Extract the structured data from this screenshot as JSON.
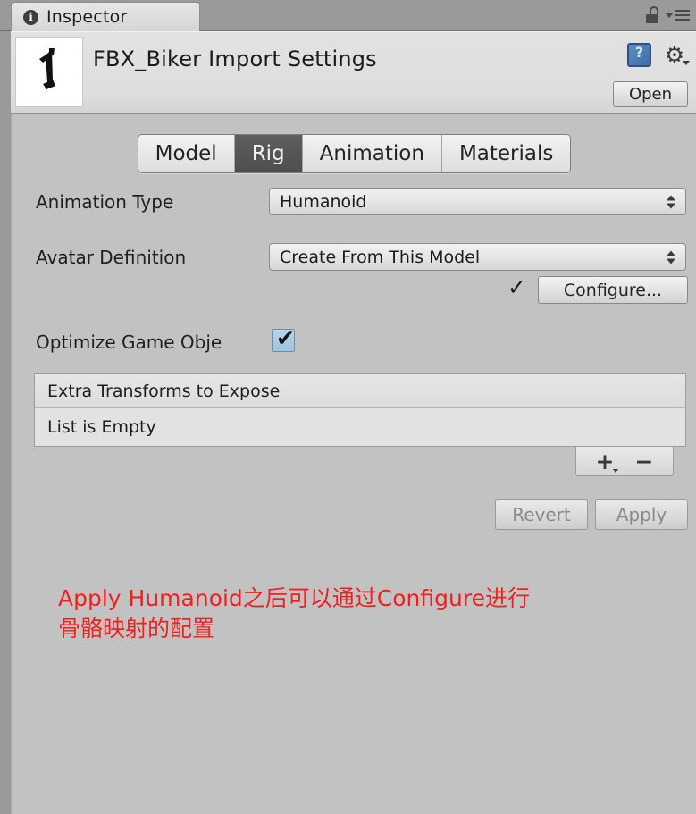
{
  "window": {
    "tab_label": "Inspector",
    "info_icon": "info-icon",
    "lock_icon": "lock-icon",
    "menu_icon": "hamburger-menu-icon"
  },
  "header": {
    "title": "FBX_Biker Import Settings",
    "help_icon": "help-book-icon",
    "gear_icon": "gear-icon",
    "open_label": "Open",
    "thumbnail": "fbx-model-thumbnail"
  },
  "tabs": [
    {
      "label": "Model",
      "active": false
    },
    {
      "label": "Rig",
      "active": true
    },
    {
      "label": "Animation",
      "active": false
    },
    {
      "label": "Materials",
      "active": false
    }
  ],
  "properties": {
    "animation_type": {
      "label": "Animation Type",
      "value": "Humanoid"
    },
    "avatar_definition": {
      "label": "Avatar Definition",
      "value": "Create From This Model"
    },
    "configure": {
      "check": "✓",
      "label": "Configure..."
    },
    "optimize_game_objects": {
      "label": "Optimize Game Obje",
      "checked": true,
      "check_mark": "✔"
    }
  },
  "extra_transforms": {
    "header": "Extra Transforms to Expose",
    "empty_text": "List is Empty",
    "add_label": "+",
    "remove_label": "−"
  },
  "footer": {
    "revert_label": "Revert",
    "apply_label": "Apply",
    "revert_disabled": true,
    "apply_disabled": true
  },
  "annotation": {
    "line1": "Apply Humanoid之后可以通过Configure进行",
    "line2": "骨骼映射的配置",
    "color": "#f02020"
  }
}
